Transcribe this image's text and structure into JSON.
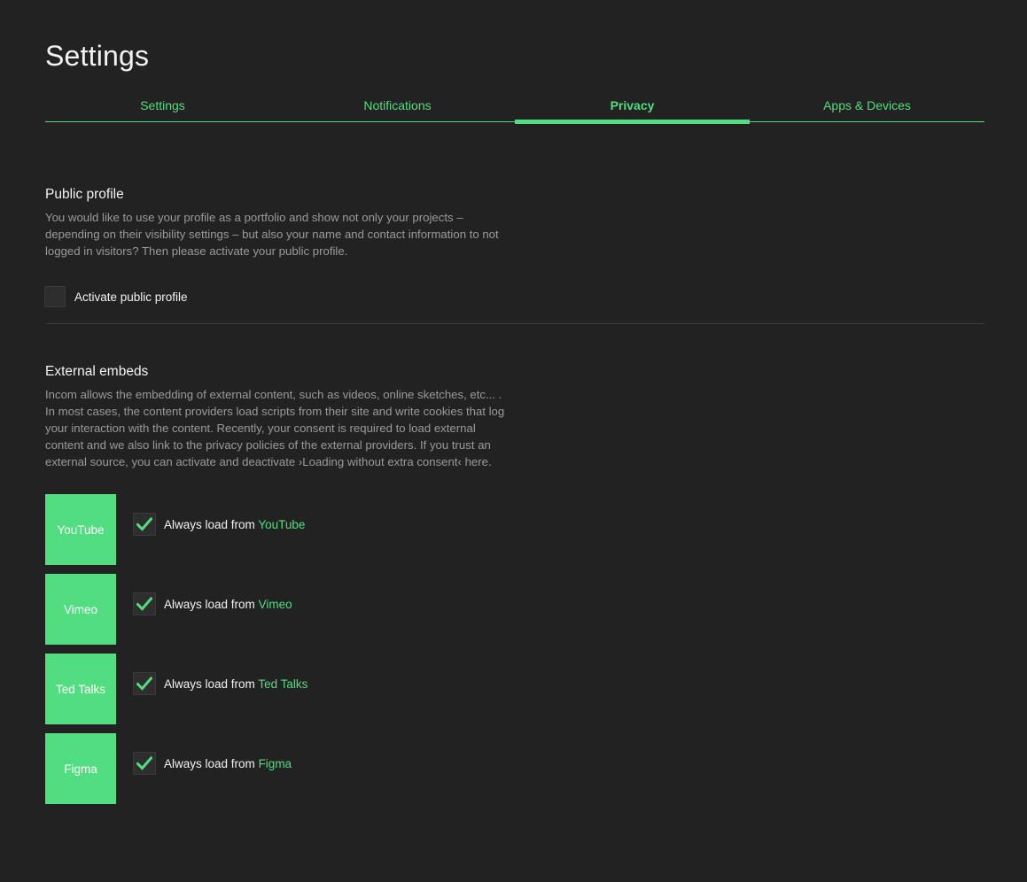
{
  "page": {
    "title": "Settings"
  },
  "tabs": [
    {
      "label": "Settings",
      "active": false
    },
    {
      "label": "Notifications",
      "active": false
    },
    {
      "label": "Privacy",
      "active": true
    },
    {
      "label": "Apps & Devices",
      "active": false
    }
  ],
  "public_profile": {
    "title": "Public profile",
    "description": "You would like to use your profile as a portfolio and show not only your projects – depending on their visibility settings – but also your name and contact information to not logged in visitors? Then please activate your public profile.",
    "checkbox_label": "Activate public profile",
    "checked": false
  },
  "external_embeds": {
    "title": "External embeds",
    "description": "Incom allows the embedding of external content, such as videos, online sketches, etc... . In most cases, the content providers load scripts from their site and write cookies that log your interaction with the content. Recently, your consent is required to load external content and we also link to the privacy policies of the external providers. If you trust an external source, you can activate and deactivate ›Loading without extra consent‹ here.",
    "always_load_prefix": "Always load from",
    "providers": [
      {
        "name": "YouTube",
        "checked": true
      },
      {
        "name": "Vimeo",
        "checked": true
      },
      {
        "name": "Ted Talks",
        "checked": true
      },
      {
        "name": "Figma",
        "checked": true
      }
    ]
  },
  "colors": {
    "background": "#222222",
    "accent": "#52dd80",
    "muted_text": "#9a9a9a",
    "checkbox_bg": "#2e2e2e"
  },
  "icons": {
    "check": "checkmark-icon"
  }
}
